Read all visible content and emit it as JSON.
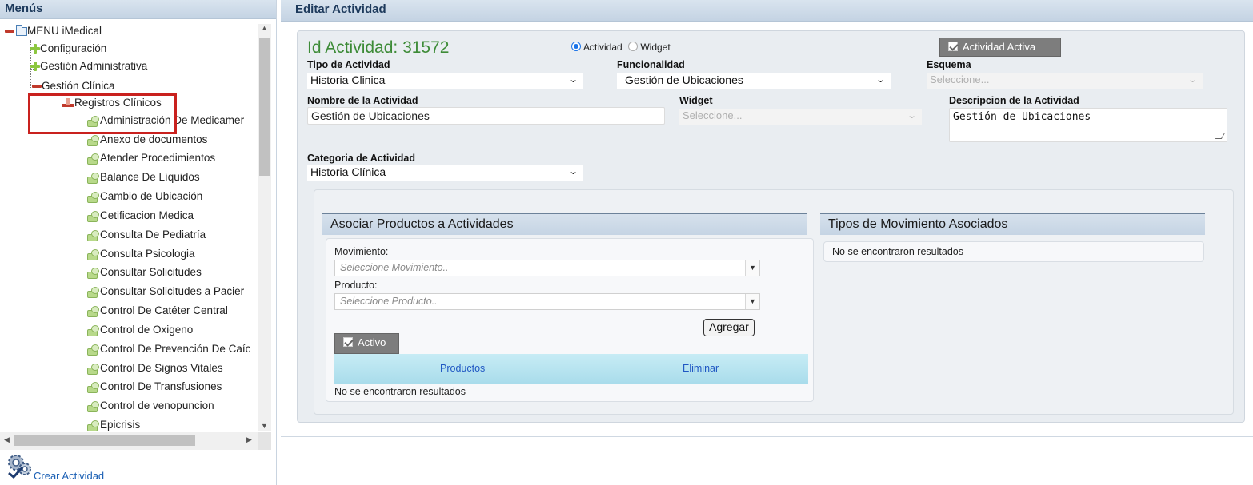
{
  "left_panel": {
    "title": "Menús",
    "tree": {
      "root": "MENU iMedical",
      "configuracion": "Configuración",
      "gestion_administrativa": "Gestión Administrativa",
      "gestion_clinica": "Gestión Clínica",
      "registros_clinicos": "Registros Clínicos",
      "leaves": [
        "Administración De Medicamer",
        "Anexo de documentos",
        "Atender Procedimientos",
        "Balance De Líquidos",
        "Cambio de Ubicación",
        "Cetificacion Medica",
        "Consulta De Pediatría",
        "Consulta Psicologia",
        "Consultar Solicitudes",
        "Consultar Solicitudes a Pacier",
        "Control De Catéter Central",
        "Control de Oxigeno",
        "Control De Prevención De Caíc",
        "Control De Signos Vitales",
        "Control De Transfusiones",
        "Control de venopuncion",
        "Epicrisis"
      ]
    },
    "create_link": "Crear Actividad"
  },
  "right_panel": {
    "title": "Editar Actividad",
    "id_label": "Id Actividad: 31572",
    "radio_actividad": "Actividad",
    "radio_widget": "Widget",
    "active_toggle": "Actividad Activa",
    "tipo_label": "Tipo de Actividad",
    "tipo_value": "Historia Clinica",
    "funcionalidad_label": "Funcionalidad",
    "funcionalidad_value": "Gestión de Ubicaciones",
    "esquema_label": "Esquema",
    "esquema_placeholder": "Seleccione...",
    "nombre_label": "Nombre de la Actividad",
    "nombre_value": "Gestión de Ubicaciones",
    "widget_label": "Widget",
    "widget_placeholder": "Seleccione...",
    "descripcion_label": "Descripcion de la Actividad",
    "descripcion_value": "Gestión de Ubicaciones",
    "categoria_label": "Categoria de Actividad",
    "categoria_value": "Historia Clínica",
    "productos_section": {
      "title": "Asociar Productos a Actividades",
      "movimiento_label": "Movimiento:",
      "movimiento_placeholder": "Seleccione Movimiento..",
      "producto_label": "Producto:",
      "producto_placeholder": "Seleccione Producto..",
      "agregar_button": "Agregar",
      "activo_toggle": "Activo",
      "columns": [
        "Productos",
        "Eliminar"
      ],
      "empty_text": "No se encontraron resultados"
    },
    "movimientos_section": {
      "title": "Tipos de Movimiento Asociados",
      "empty_text": "No se encontraron resultados"
    }
  },
  "colors": {
    "id_green": "#3d8b37",
    "header_blue": "#c4d3e3",
    "highlight_red": "#c9211e",
    "link_blue": "#1a5fb4",
    "table_header_cyan": "#a9dceb"
  }
}
